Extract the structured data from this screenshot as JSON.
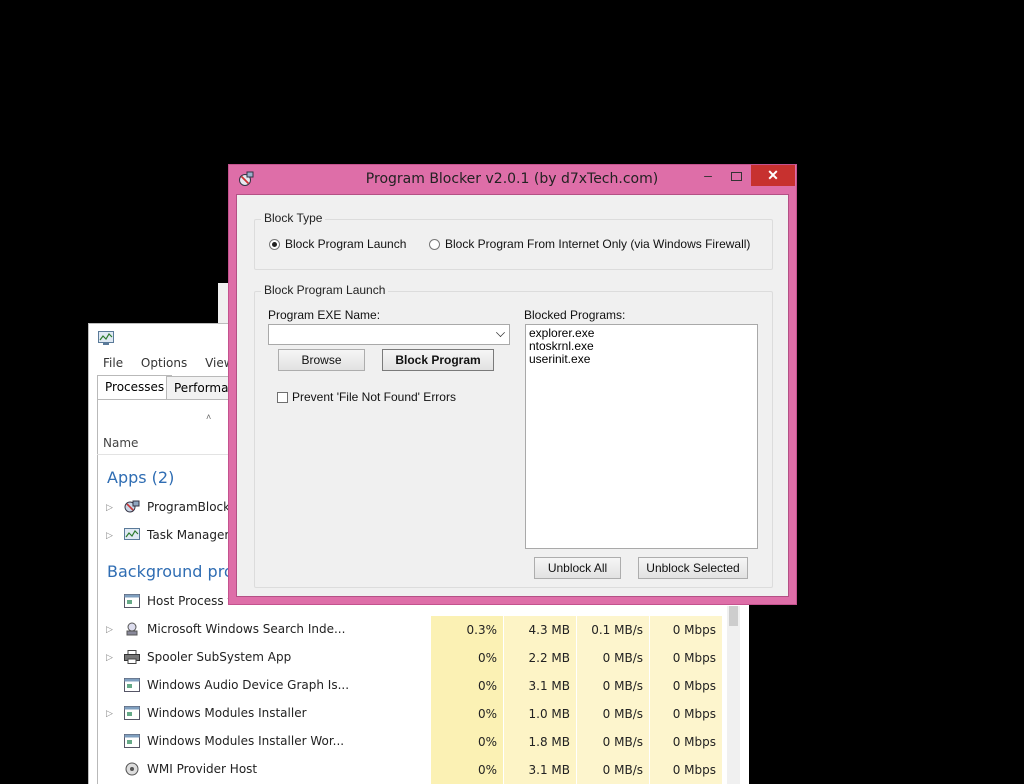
{
  "task_manager": {
    "menu": [
      "File",
      "Options",
      "View"
    ],
    "tabs": [
      "Processes",
      "Performance"
    ],
    "column_name": "Name",
    "groups": {
      "apps": "Apps (2)",
      "background": "Background processes"
    },
    "apps": [
      {
        "name": "ProgramBlocker"
      },
      {
        "name": "Task Manager"
      }
    ],
    "background": [
      {
        "name": "Host Process for Windows Tasks",
        "cpu": "",
        "mem": "",
        "disk": "",
        "net": ""
      },
      {
        "name": "Microsoft Windows Search Inde...",
        "cpu": "0.3%",
        "mem": "4.3 MB",
        "disk": "0.1 MB/s",
        "net": "0 Mbps"
      },
      {
        "name": "Spooler SubSystem App",
        "cpu": "0%",
        "mem": "2.2 MB",
        "disk": "0 MB/s",
        "net": "0 Mbps"
      },
      {
        "name": "Windows Audio Device Graph Is...",
        "cpu": "0%",
        "mem": "3.1 MB",
        "disk": "0 MB/s",
        "net": "0 Mbps"
      },
      {
        "name": "Windows Modules Installer",
        "cpu": "0%",
        "mem": "1.0 MB",
        "disk": "0 MB/s",
        "net": "0 Mbps"
      },
      {
        "name": "Windows Modules Installer Wor...",
        "cpu": "0%",
        "mem": "1.8 MB",
        "disk": "0 MB/s",
        "net": "0 Mbps"
      },
      {
        "name": "WMI Provider Host",
        "cpu": "0%",
        "mem": "3.1 MB",
        "disk": "0 MB/s",
        "net": "0 Mbps"
      }
    ]
  },
  "program_blocker": {
    "title": "Program Blocker  v2.0.1 (by d7xTech.com)",
    "block_type": {
      "legend": "Block Type",
      "options": [
        "Block Program Launch",
        "Block Program From Internet Only (via Windows Firewall)"
      ],
      "selected": 0
    },
    "launch": {
      "legend": "Block Program Launch",
      "exe_label": "Program EXE Name:",
      "exe_value": "",
      "browse": "Browse",
      "block_program": "Block Program",
      "prevent_label": "Prevent 'File Not Found' Errors",
      "prevent_checked": false,
      "blocked_label": "Blocked Programs:",
      "blocked": [
        "explorer.exe",
        "ntoskrnl.exe",
        "userinit.exe"
      ],
      "unblock_all": "Unblock All",
      "unblock_selected": "Unblock Selected"
    }
  }
}
